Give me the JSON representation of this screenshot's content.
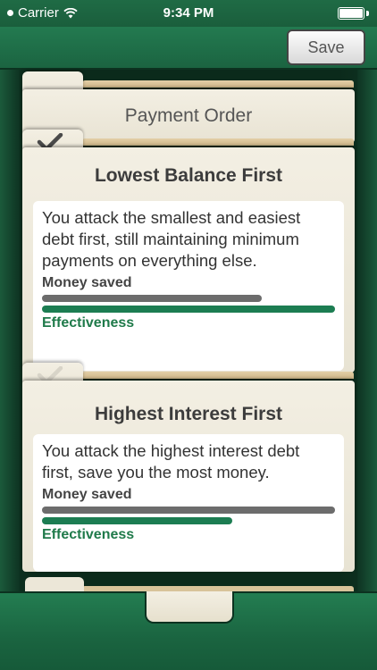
{
  "status_bar": {
    "carrier": "Carrier",
    "time": "9:34 PM"
  },
  "header": {
    "save_label": "Save"
  },
  "title_card": {
    "title": "Payment Order"
  },
  "options": [
    {
      "title": "Lowest Balance First",
      "selected": true,
      "description": "You attack the smallest and easiest debt first, still maintaining minimum payments on everything else.",
      "money_saved_label": "Money saved",
      "money_saved_level": 0.75,
      "effectiveness_label": "Effectiveness",
      "effectiveness_level": 1.0
    },
    {
      "title": "Highest Interest First",
      "selected": false,
      "description": "You attack the highest interest debt first, save you the most money.",
      "money_saved_label": "Money saved",
      "money_saved_level": 1.0,
      "effectiveness_label": "Effectiveness",
      "effectiveness_level": 0.65
    }
  ],
  "colors": {
    "brand_green": "#1f6b45",
    "bar_gray": "#6c6c6c",
    "bar_green": "#1c7d52"
  },
  "icons": [
    "wifi-icon",
    "battery-icon",
    "checkmark-icon"
  ]
}
